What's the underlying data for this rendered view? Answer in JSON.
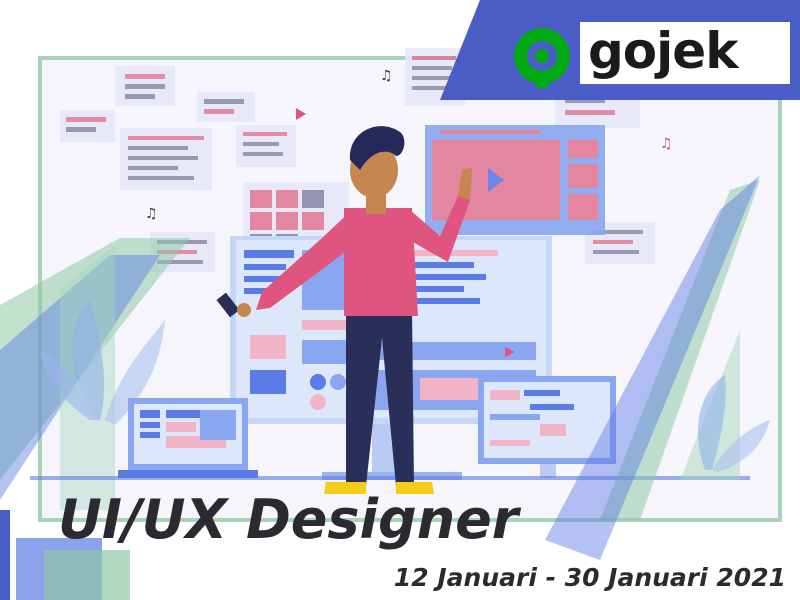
{
  "brand": {
    "name": "gojek",
    "logo_color": "#00aa13",
    "banner_color": "#4a5cc6"
  },
  "headline": {
    "title": "UI/UX Designer",
    "dates": "12 Januari - 30 Januari 2021"
  },
  "palette": {
    "accent_blue": "#5b7be6",
    "accent_green": "#8fc8a8",
    "pink": "#e07a98",
    "shirt": "#e0557f",
    "pants": "#2a2f5a",
    "skin": "#c68650",
    "hair": "#26285c"
  }
}
